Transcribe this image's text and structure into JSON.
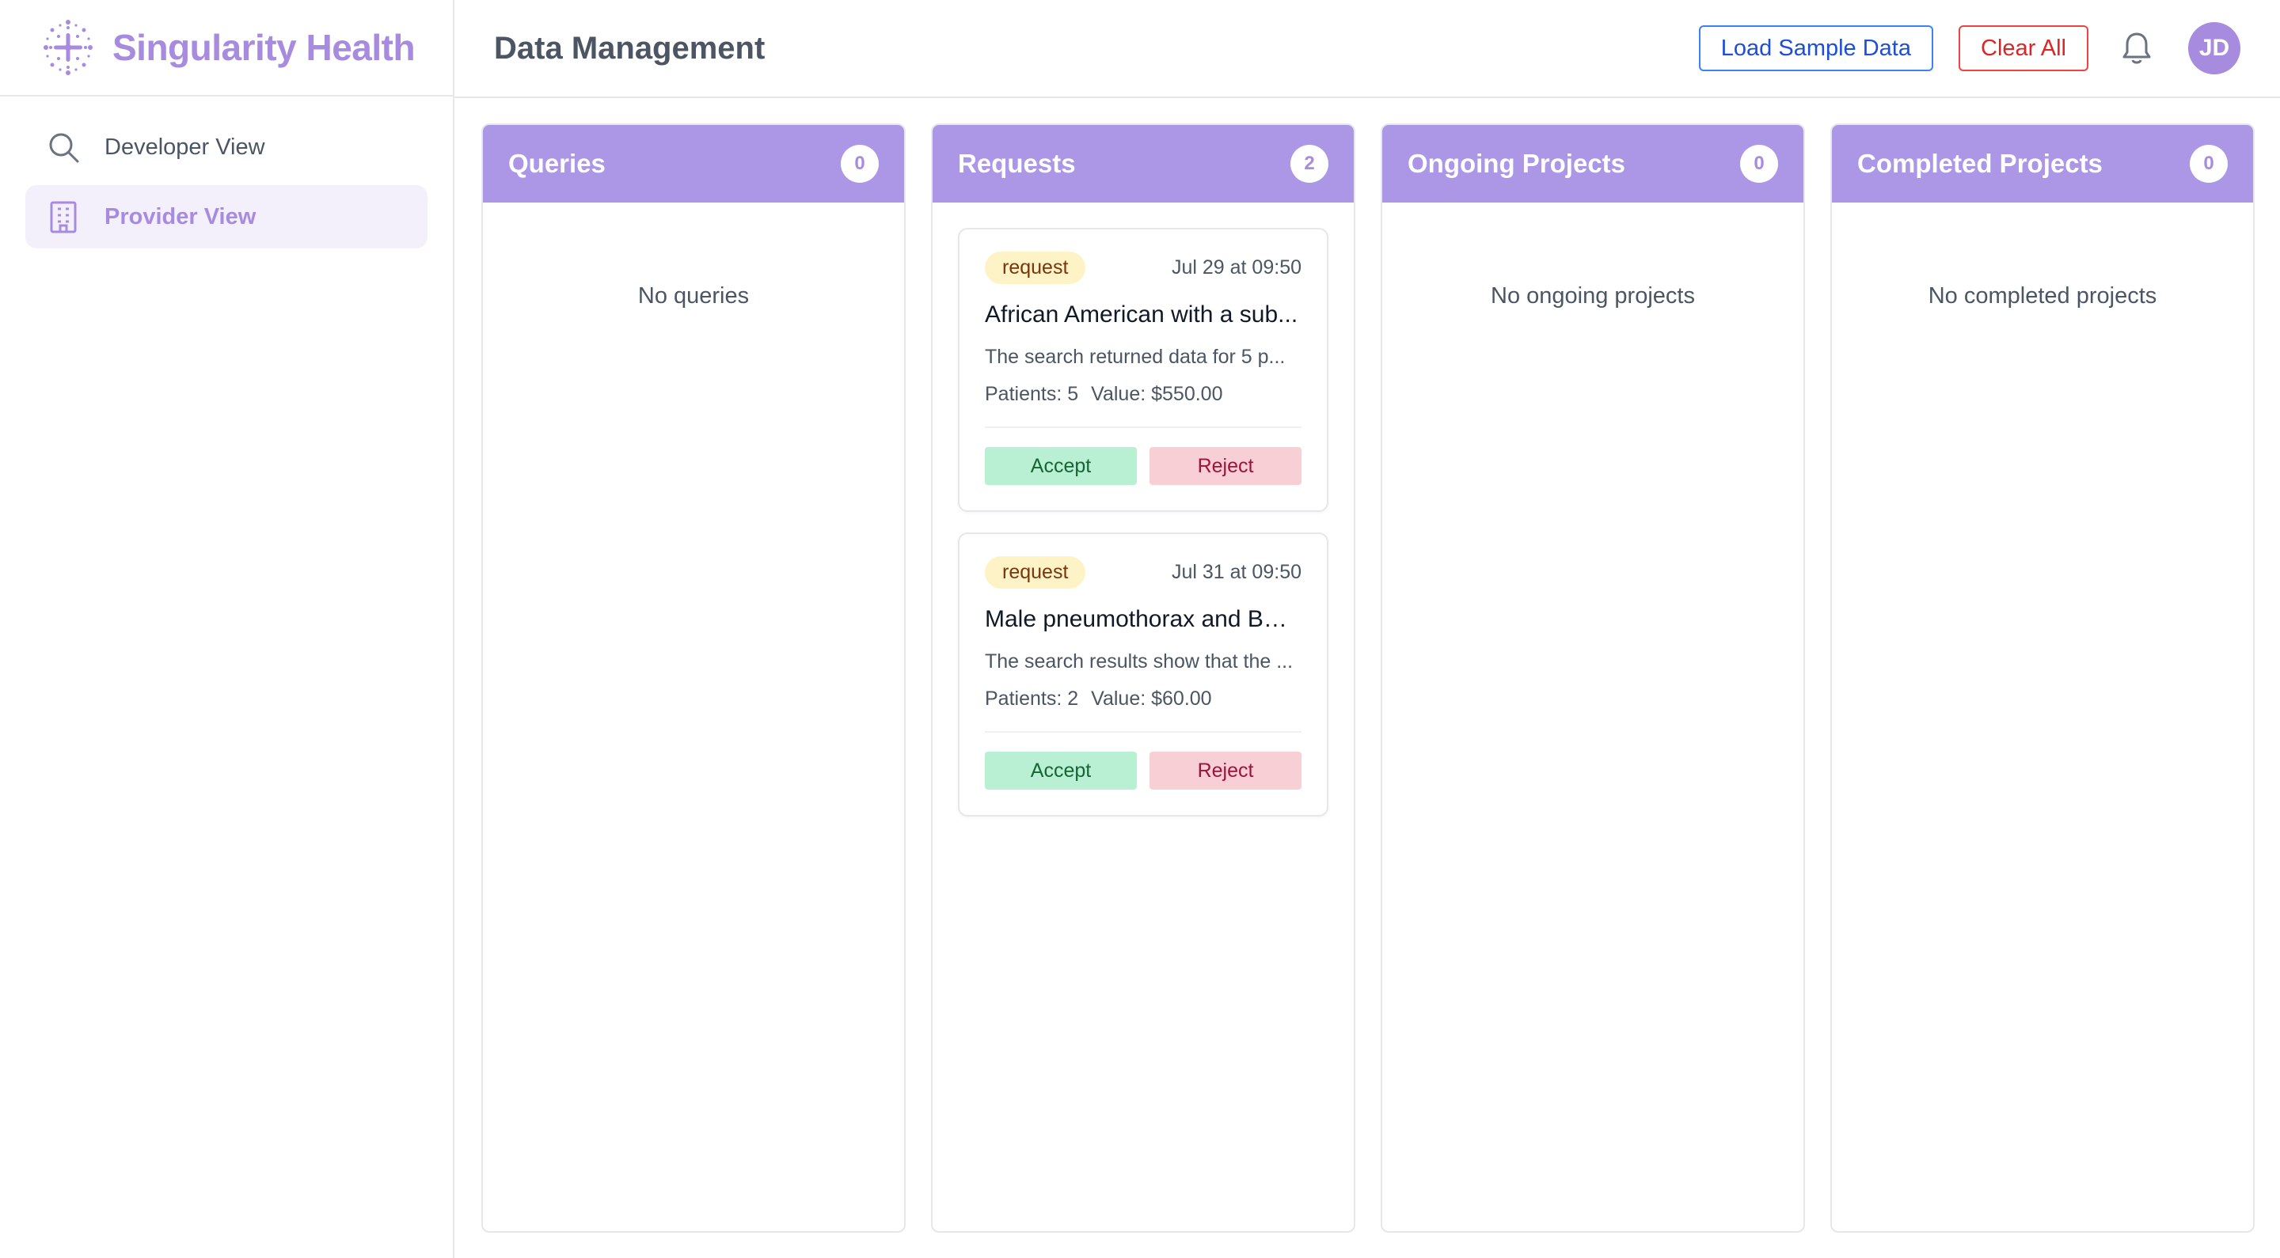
{
  "brand": {
    "name": "Singularity Health"
  },
  "sidebar": {
    "items": [
      {
        "label": "Developer View",
        "icon": "search-icon",
        "active": false
      },
      {
        "label": "Provider View",
        "icon": "building-icon",
        "active": true
      }
    ]
  },
  "header": {
    "title": "Data Management",
    "load_sample_label": "Load Sample Data",
    "clear_all_label": "Clear All",
    "avatar_initials": "JD"
  },
  "board": {
    "columns": [
      {
        "title": "Queries",
        "count": "0",
        "empty_text": "No queries"
      },
      {
        "title": "Requests",
        "count": "2",
        "cards": [
          {
            "tag": "request",
            "date": "Jul 29 at 09:50",
            "title": "African American with a sub...",
            "description": "The search returned data for 5 p...",
            "patients": "Patients: 5",
            "value": "Value: $550.00",
            "accept_label": "Accept",
            "reject_label": "Reject"
          },
          {
            "tag": "request",
            "date": "Jul 31 at 09:50",
            "title": "Male pneumothorax and BM...",
            "description": "The search results show that the ...",
            "patients": "Patients: 2",
            "value": "Value: $60.00",
            "accept_label": "Accept",
            "reject_label": "Reject"
          }
        ]
      },
      {
        "title": "Ongoing Projects",
        "count": "0",
        "empty_text": "No ongoing projects"
      },
      {
        "title": "Completed Projects",
        "count": "0",
        "empty_text": "No completed projects"
      }
    ]
  },
  "colors": {
    "accent": "#a78bdf",
    "column_header": "#ab97e5",
    "accept_bg": "#b9f0d3",
    "reject_bg": "#f9cfd6",
    "tag_bg": "#fef3c7"
  }
}
